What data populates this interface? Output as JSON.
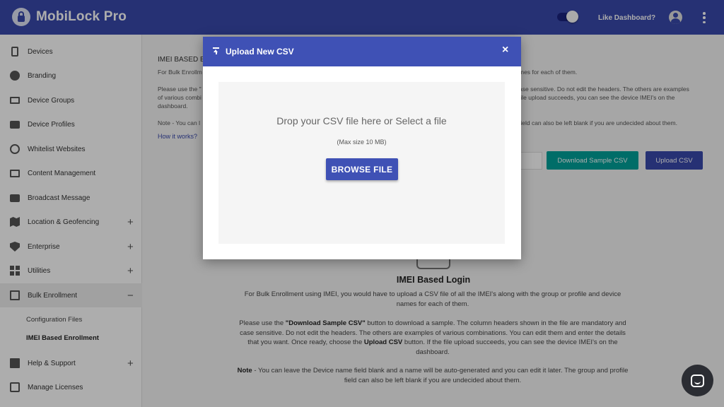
{
  "app": {
    "title": "MobiLock Pro"
  },
  "header": {
    "like_dashboard": "Like Dashboard?"
  },
  "sidebar": {
    "items": [
      {
        "label": "Devices",
        "icon": "phone-icon"
      },
      {
        "label": "Branding",
        "icon": "palette-icon"
      },
      {
        "label": "Device Groups",
        "icon": "devices-icon"
      },
      {
        "label": "Device Profiles",
        "icon": "briefcase-icon"
      },
      {
        "label": "Whitelist Websites",
        "icon": "globe-icon"
      },
      {
        "label": "Content Management",
        "icon": "folder-icon"
      },
      {
        "label": "Broadcast Message",
        "icon": "message-icon"
      },
      {
        "label": "Location & Geofencing",
        "icon": "map-icon",
        "expand": "+"
      },
      {
        "label": "Enterprise",
        "icon": "shield-icon",
        "expand": "+"
      },
      {
        "label": "Utilities",
        "icon": "grid-icon",
        "expand": "+"
      },
      {
        "label": "Bulk Enrollment",
        "icon": "enter-icon",
        "expand": "−"
      },
      {
        "label": "Help & Support",
        "icon": "book-icon",
        "expand": "+"
      },
      {
        "label": "Manage Licenses",
        "icon": "license-icon"
      }
    ],
    "sub_items": [
      {
        "label": "Configuration Files"
      },
      {
        "label": "IMEI Based Enrollment"
      }
    ]
  },
  "main": {
    "bg_title": "IMEI BASED E",
    "bg_lines": [
      "For Bulk Enrollm",
      "Please use the \"",
      "of various combi",
      "dashboard.",
      "Note - You can l"
    ],
    "bg_lines_right": [
      "mes for each of them.",
      "ase sensitive. Do not edit the headers. The others are examples",
      "file upload succeeds, you can see the device IMEI's on the",
      "field can also be left blank if you are undecided about them."
    ],
    "how_it_works": "How it works?",
    "download_sample": "Download Sample CSV",
    "upload_csv": "Upload CSV",
    "section_title": "IMEI Based Login",
    "para1": "For Bulk Enrollment using IMEI, you would have to upload a CSV file of all the IMEI's along with the group or profile and device names for each of them.",
    "para2_a": "Please use the ",
    "para2_b": "\"Download Sample CSV\"",
    "para2_c": " button to download a sample. The column headers shown in the file are mandatory and case sensitive. Do not edit the headers. The others are examples of various combinations. You can edit them and enter the details that you want. Once ready, choose the ",
    "para2_d": "Upload CSV",
    "para2_e": " button. If the file upload succeeds, you can see the device IMEI's on the dashboard.",
    "para3_a": "Note",
    "para3_b": " - You can leave the Device name field blank and a name will be auto-generated and you can edit it later. The group and profile field can also be left blank if you are undecided about them."
  },
  "modal": {
    "title": "Upload New CSV",
    "close": "×",
    "drop_text": "Drop your CSV file here or Select a file",
    "max_size": "(Max size 10 MB)",
    "browse": "BROWSE FILE"
  },
  "colors": {
    "primary": "#3949ab",
    "modal_header": "#3f51b5",
    "teal": "#00a19a"
  }
}
